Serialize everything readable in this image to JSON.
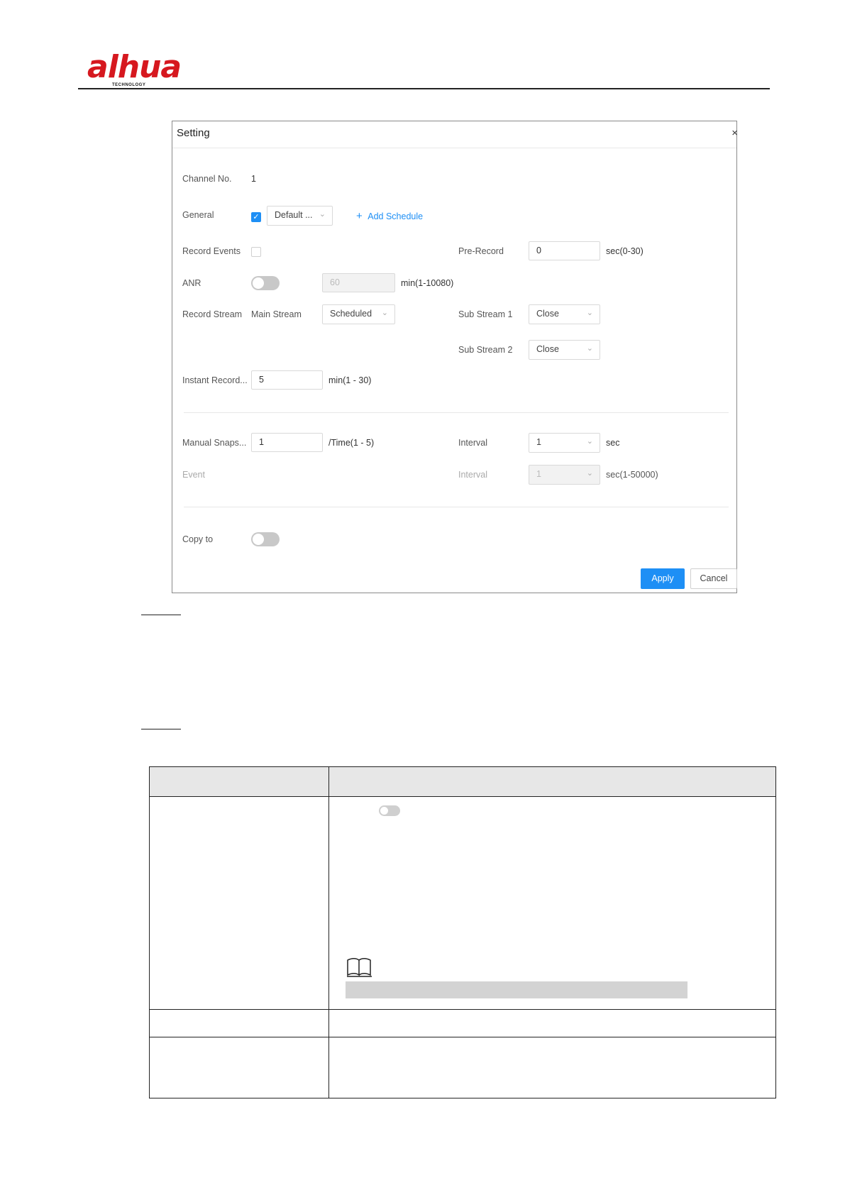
{
  "header": {
    "logo_text": "alhua",
    "logo_subtext": "TECHNOLOGY"
  },
  "dialog": {
    "title": "Setting",
    "close_glyph": "×",
    "channel_no": {
      "label": "Channel No.",
      "value": "1"
    },
    "general": {
      "label": "General",
      "checked": true,
      "schedule_select": "Default ...",
      "add_schedule_label": "Add Schedule"
    },
    "record_events": {
      "label": "Record Events",
      "checked": false
    },
    "pre_record": {
      "label": "Pre-Record",
      "value": "0",
      "unit": "sec(0-30)"
    },
    "anr": {
      "label": "ANR",
      "enabled": false,
      "value": "60",
      "unit": "min(1-10080)"
    },
    "record_stream": {
      "label": "Record Stream",
      "main_label": "Main Stream",
      "main_select": "Scheduled"
    },
    "sub_stream_1": {
      "label": "Sub Stream 1",
      "select": "Close"
    },
    "sub_stream_2": {
      "label": "Sub Stream 2",
      "select": "Close"
    },
    "instant_record": {
      "label": "Instant Record...",
      "value": "5",
      "unit": "min(1 - 30)"
    },
    "manual_snapshot": {
      "label": "Manual Snaps...",
      "value": "1",
      "unit": "/Time(1 - 5)"
    },
    "manual_interval": {
      "label": "Interval",
      "select": "1",
      "unit": "sec"
    },
    "event": {
      "label": "Event"
    },
    "event_interval": {
      "label": "Interval",
      "select": "1",
      "unit": "sec(1-50000)"
    },
    "copy_to": {
      "label": "Copy to",
      "enabled": false
    },
    "apply_label": "Apply",
    "cancel_label": "Cancel"
  },
  "colors": {
    "accent": "#1e8ff5",
    "brand": "#d6181f",
    "table_header": "#e7e7e7"
  },
  "icons": {
    "note": "book-icon",
    "toggle": "toggle-switch-icon"
  }
}
